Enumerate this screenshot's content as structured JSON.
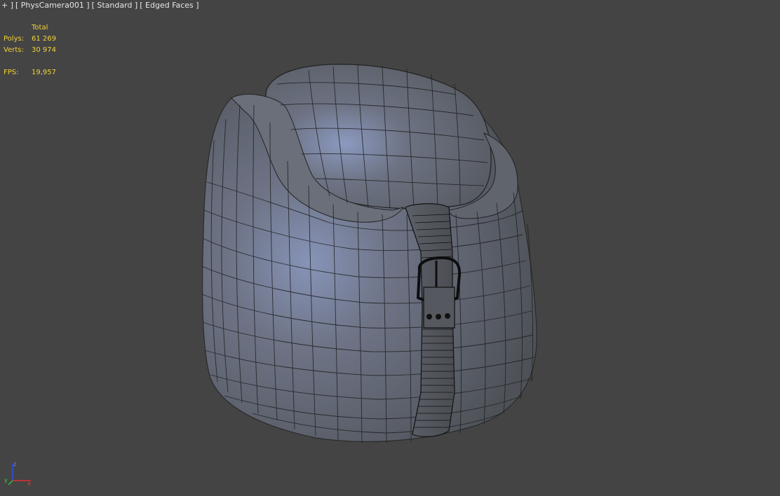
{
  "viewport": {
    "menu_plus": "+ ]",
    "camera": "[ PhysCamera001 ]",
    "shading_mode": "[ Standard ]",
    "display_mode": "[ Edged Faces ]"
  },
  "stats": {
    "header": "Total",
    "polys_label": "Polys:",
    "polys_value": "61 269",
    "verts_label": "Verts:",
    "verts_value": "30 974",
    "fps_label": "FPS:",
    "fps_value": "19,957",
    "text_color": "#f0d23a"
  },
  "colors": {
    "background": "#444444",
    "mesh_fill": "#6b7078",
    "mesh_highlight": "#8a98bb",
    "wire": "#1a1a1a",
    "axis_x": "#e03030",
    "axis_y": "#30c030",
    "axis_z": "#3050e0"
  },
  "gizmo": {
    "x_label": "x",
    "y_label": "y",
    "z_label": "z"
  }
}
